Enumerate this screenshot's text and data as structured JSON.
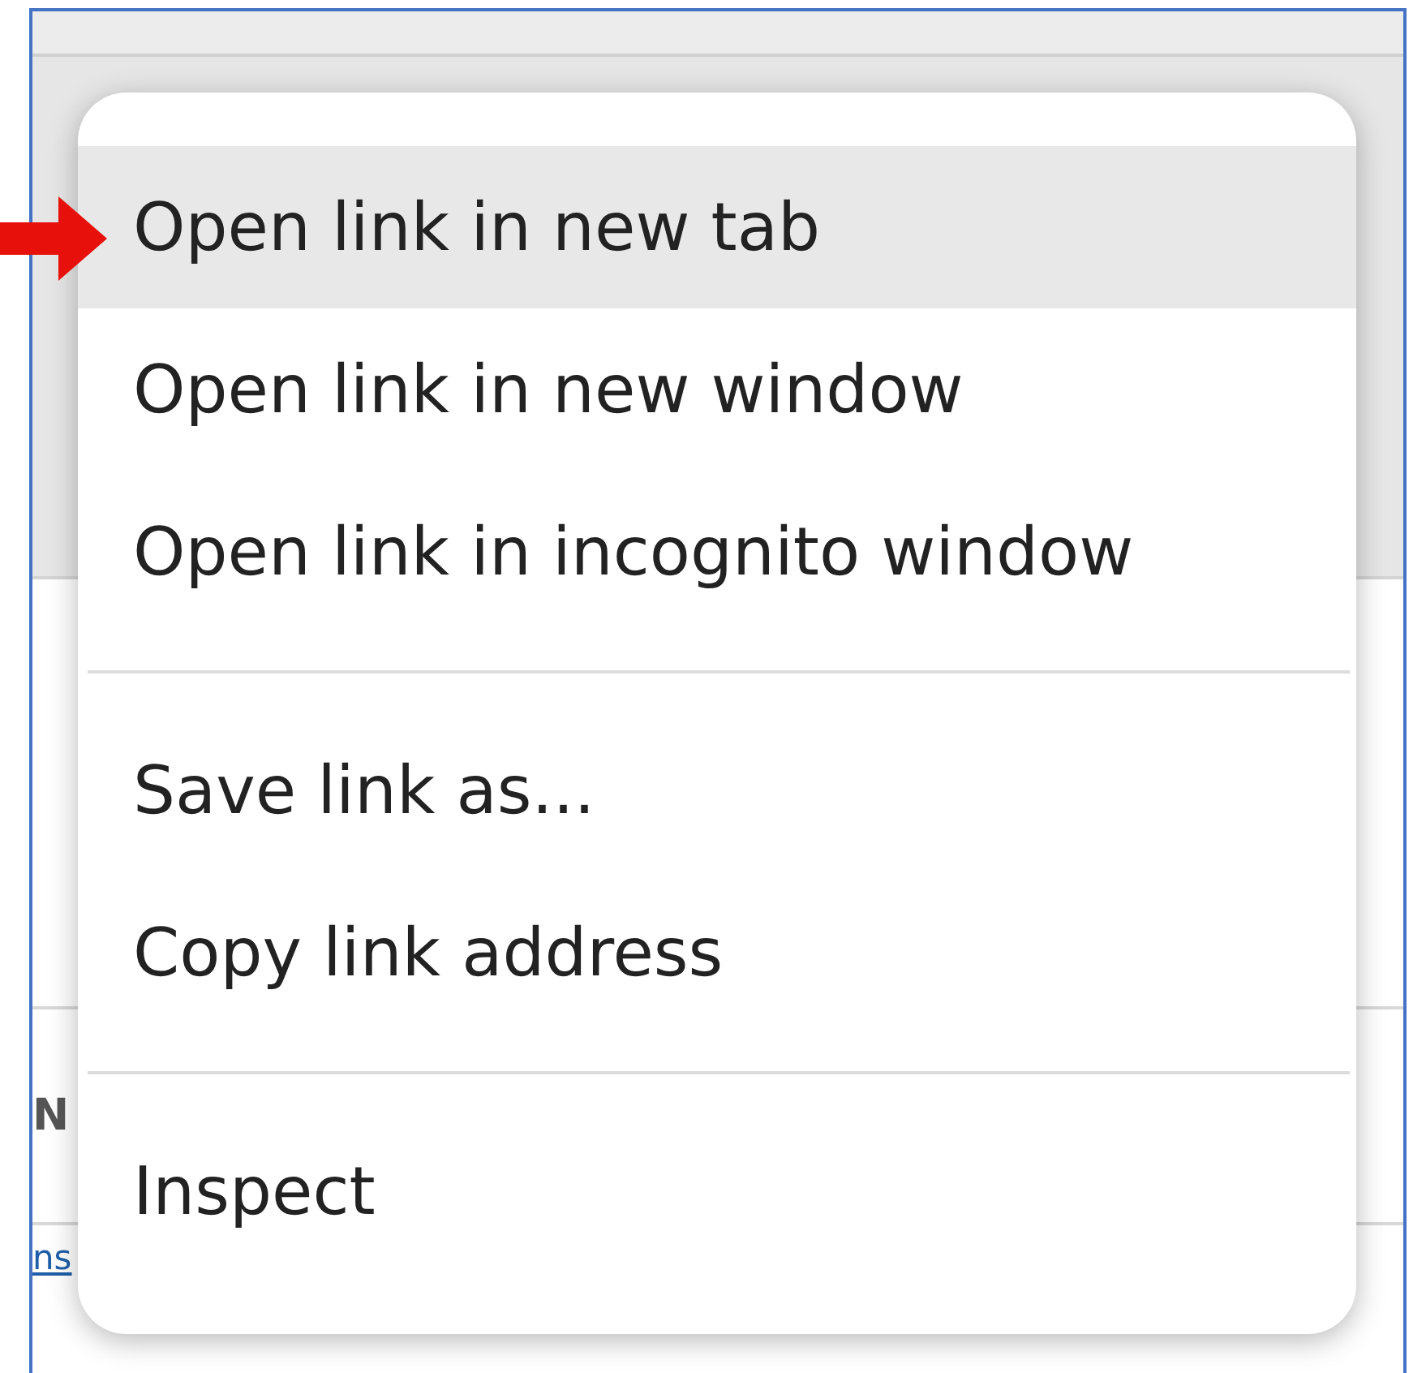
{
  "background": {
    "column_header_fragment": "N",
    "link_fragment": "ns"
  },
  "context_menu": {
    "items": [
      {
        "kind": "item",
        "label": "Open link in new tab",
        "selected": true
      },
      {
        "kind": "item",
        "label": "Open link in new window",
        "selected": false
      },
      {
        "kind": "item",
        "label": "Open link in incognito window",
        "selected": false
      },
      {
        "kind": "separator"
      },
      {
        "kind": "item",
        "label": "Save link as...",
        "selected": false
      },
      {
        "kind": "item",
        "label": "Copy link address",
        "selected": false
      },
      {
        "kind": "separator"
      },
      {
        "kind": "item",
        "label": "Inspect",
        "selected": false
      }
    ]
  }
}
